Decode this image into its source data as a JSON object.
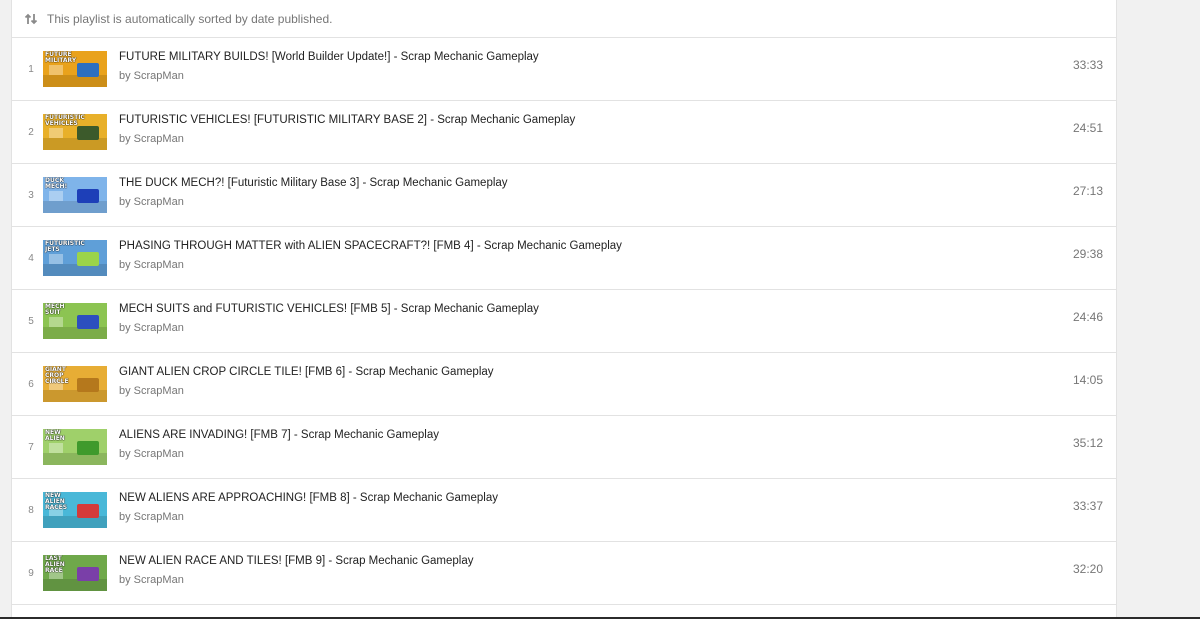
{
  "notice": {
    "text": "This playlist is automatically sorted by date published.",
    "icon": "sort-icon"
  },
  "colors": {
    "background": "#f1f1f1",
    "panel": "#ffffff",
    "divider": "#e2e2e2",
    "muted": "#767676"
  },
  "videos": [
    {
      "index": "1",
      "title": "FUTURE MILITARY BUILDS! [World Builder Update!] - Scrap Mechanic Gameplay",
      "owner": "by ScrapMan",
      "duration": "33:33",
      "thumb_caption": "FUTURE MILITARY",
      "thumb_bg": "#e9a21c",
      "thumb_accent": "#2d6fbf"
    },
    {
      "index": "2",
      "title": "FUTURISTIC VEHICLES! [FUTURISTIC MILITARY BASE 2] - Scrap Mechanic Gameplay",
      "owner": "by ScrapMan",
      "duration": "24:51",
      "thumb_caption": "FUTURISTIC VEHICLES",
      "thumb_bg": "#e8b02a",
      "thumb_accent": "#3c5a2b"
    },
    {
      "index": "3",
      "title": "THE DUCK MECH?! [Futuristic Military Base 3] - Scrap Mechanic Gameplay",
      "owner": "by ScrapMan",
      "duration": "27:13",
      "thumb_caption": "DUCK MECH!",
      "thumb_bg": "#7fb4ea",
      "thumb_accent": "#1d3fb8"
    },
    {
      "index": "4",
      "title": "PHASING THROUGH MATTER with ALIEN SPACECRAFT?! [FMB 4] - Scrap Mechanic Gameplay",
      "owner": "by ScrapMan",
      "duration": "29:38",
      "thumb_caption": "FUTURISTIC JETS",
      "thumb_bg": "#5f9fd8",
      "thumb_accent": "#9bd44a"
    },
    {
      "index": "5",
      "title": "MECH SUITS and FUTURISTIC VEHICLES! [FMB 5] - Scrap Mechanic Gameplay",
      "owner": "by ScrapMan",
      "duration": "24:46",
      "thumb_caption": "MECH SUIT",
      "thumb_bg": "#8cc452",
      "thumb_accent": "#2c4fbf"
    },
    {
      "index": "6",
      "title": "GIANT ALIEN CROP CIRCLE TILE! [FMB 6] - Scrap Mechanic Gameplay",
      "owner": "by ScrapMan",
      "duration": "14:05",
      "thumb_caption": "GIANT CROP CIRCLE",
      "thumb_bg": "#e7ad35",
      "thumb_accent": "#b5781c"
    },
    {
      "index": "7",
      "title": "ALIENS ARE INVADING! [FMB 7] - Scrap Mechanic Gameplay",
      "owner": "by ScrapMan",
      "duration": "35:12",
      "thumb_caption": "NEW ALIEN",
      "thumb_bg": "#9fd06a",
      "thumb_accent": "#3f9a2c"
    },
    {
      "index": "8",
      "title": "NEW ALIENS ARE APPROACHING! [FMB 8] - Scrap Mechanic Gameplay",
      "owner": "by ScrapMan",
      "duration": "33:37",
      "thumb_caption": "NEW ALIEN RACES",
      "thumb_bg": "#49b8d8",
      "thumb_accent": "#d43a3a"
    },
    {
      "index": "9",
      "title": "NEW ALIEN RACE AND TILES! [FMB 9] - Scrap Mechanic Gameplay",
      "owner": "by ScrapMan",
      "duration": "32:20",
      "thumb_caption": "LAST ALIEN RACE",
      "thumb_bg": "#6fa84a",
      "thumb_accent": "#7a3fa8"
    }
  ]
}
